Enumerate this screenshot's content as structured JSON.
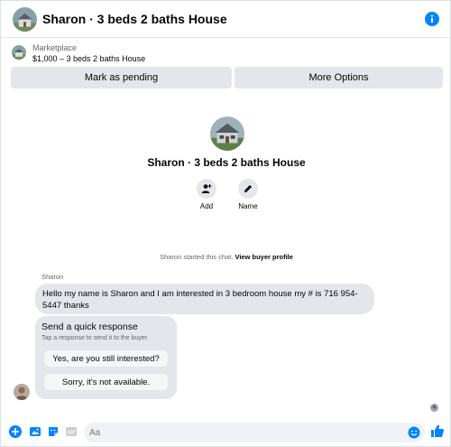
{
  "header": {
    "title": "Sharon · 3 beds 2 baths House",
    "info_icon": "info-icon"
  },
  "listing": {
    "label": "Marketplace",
    "price_title": "$1,000 – 3 beds 2 baths House",
    "mark_pending": "Mark as pending",
    "more_options": "More Options"
  },
  "profile": {
    "name": "Sharon · 3 beds 2 baths House",
    "actions": [
      {
        "label": "Add",
        "icon": "add-person-icon"
      },
      {
        "label": "Name",
        "icon": "pencil-icon"
      }
    ]
  },
  "chat": {
    "started_text": "Sharon started this chat.",
    "view_profile": "View buyer profile",
    "sender": "Sharon",
    "message": "Hello my name is Sharon and I am interested in 3 bedroom house my # is 716 954-5447 thanks",
    "quick_title": "Send a quick response",
    "quick_subtitle": "Tap a response to send it to the buyer.",
    "quick_options": [
      "Yes, are you still interested?",
      "Sorry, it's not available."
    ]
  },
  "composer": {
    "placeholder": "Aa",
    "icons": [
      "plus-icon",
      "photo-icon",
      "sticker-icon",
      "gif-icon",
      "emoji-icon",
      "like-icon"
    ]
  },
  "colors": {
    "accent": "#0084ff",
    "bubble": "#e4e6eb",
    "secondary_text": "#65676b"
  }
}
